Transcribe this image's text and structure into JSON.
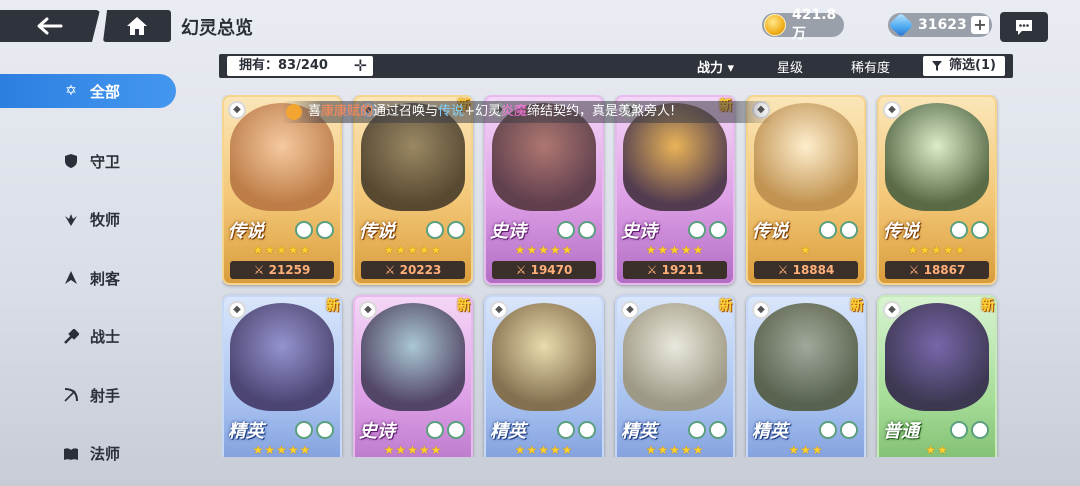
{
  "header": {
    "title": "幻灵总览",
    "gold": "421.8万",
    "gems": "31623"
  },
  "sidebar": {
    "items": [
      {
        "label": "全部",
        "icon": "all-star-icon",
        "active": true
      },
      {
        "label": "守卫",
        "icon": "shield-icon"
      },
      {
        "label": "牧师",
        "icon": "priest-icon"
      },
      {
        "label": "刺客",
        "icon": "assassin-icon"
      },
      {
        "label": "战士",
        "icon": "warrior-icon"
      },
      {
        "label": "射手",
        "icon": "archer-icon"
      },
      {
        "label": "法师",
        "icon": "book-icon"
      }
    ]
  },
  "filterbar": {
    "owned": "拥有：83/240",
    "sort_power": "战力 ▾",
    "sort_star": "星级",
    "sort_rarity": "稀有度",
    "filter": "筛选(1)"
  },
  "marquee": {
    "pre": "喜",
    "name": "康康赋的",
    "mid1": "通过召唤与",
    "legend": "传说",
    "mid2": "+幻灵",
    "hero": "炎魔",
    "post": "缔结契约，真是羡煞旁人!"
  },
  "cards": [
    {
      "rarity": "传说",
      "type": "legend",
      "stars": "★★★★★",
      "power": "⚔ 21259",
      "new": ""
    },
    {
      "rarity": "传说",
      "type": "legend",
      "stars": "★★★★★",
      "power": "⚔ 20223",
      "new": "新"
    },
    {
      "rarity": "史诗",
      "type": "epic",
      "stars": "★★★★★",
      "power": "⚔ 19470",
      "new": ""
    },
    {
      "rarity": "史诗",
      "type": "epic",
      "stars": "★★★★★",
      "power": "⚔ 19211",
      "new": "新"
    },
    {
      "rarity": "传说",
      "type": "legend",
      "stars": "★",
      "power": "⚔ 18884",
      "new": ""
    },
    {
      "rarity": "传说",
      "type": "legend",
      "stars": "★★★★★",
      "power": "⚔ 18867",
      "new": ""
    },
    {
      "rarity": "精英",
      "type": "elite",
      "stars": "★★★★★",
      "power": "",
      "new": "新"
    },
    {
      "rarity": "史诗",
      "type": "epic",
      "stars": "★★★★★",
      "power": "",
      "new": "新"
    },
    {
      "rarity": "精英",
      "type": "elite",
      "stars": "★★★★★",
      "power": "",
      "new": ""
    },
    {
      "rarity": "精英",
      "type": "elite",
      "stars": "★★★★★",
      "power": "",
      "new": "新"
    },
    {
      "rarity": "精英",
      "type": "elite",
      "stars": "★★★",
      "power": "",
      "new": "新"
    },
    {
      "rarity": "普通",
      "type": "common",
      "stars": "★★",
      "power": "",
      "new": "新"
    }
  ],
  "colors": {
    "accent": "#2c7fe0",
    "dark": "#2f333b"
  }
}
